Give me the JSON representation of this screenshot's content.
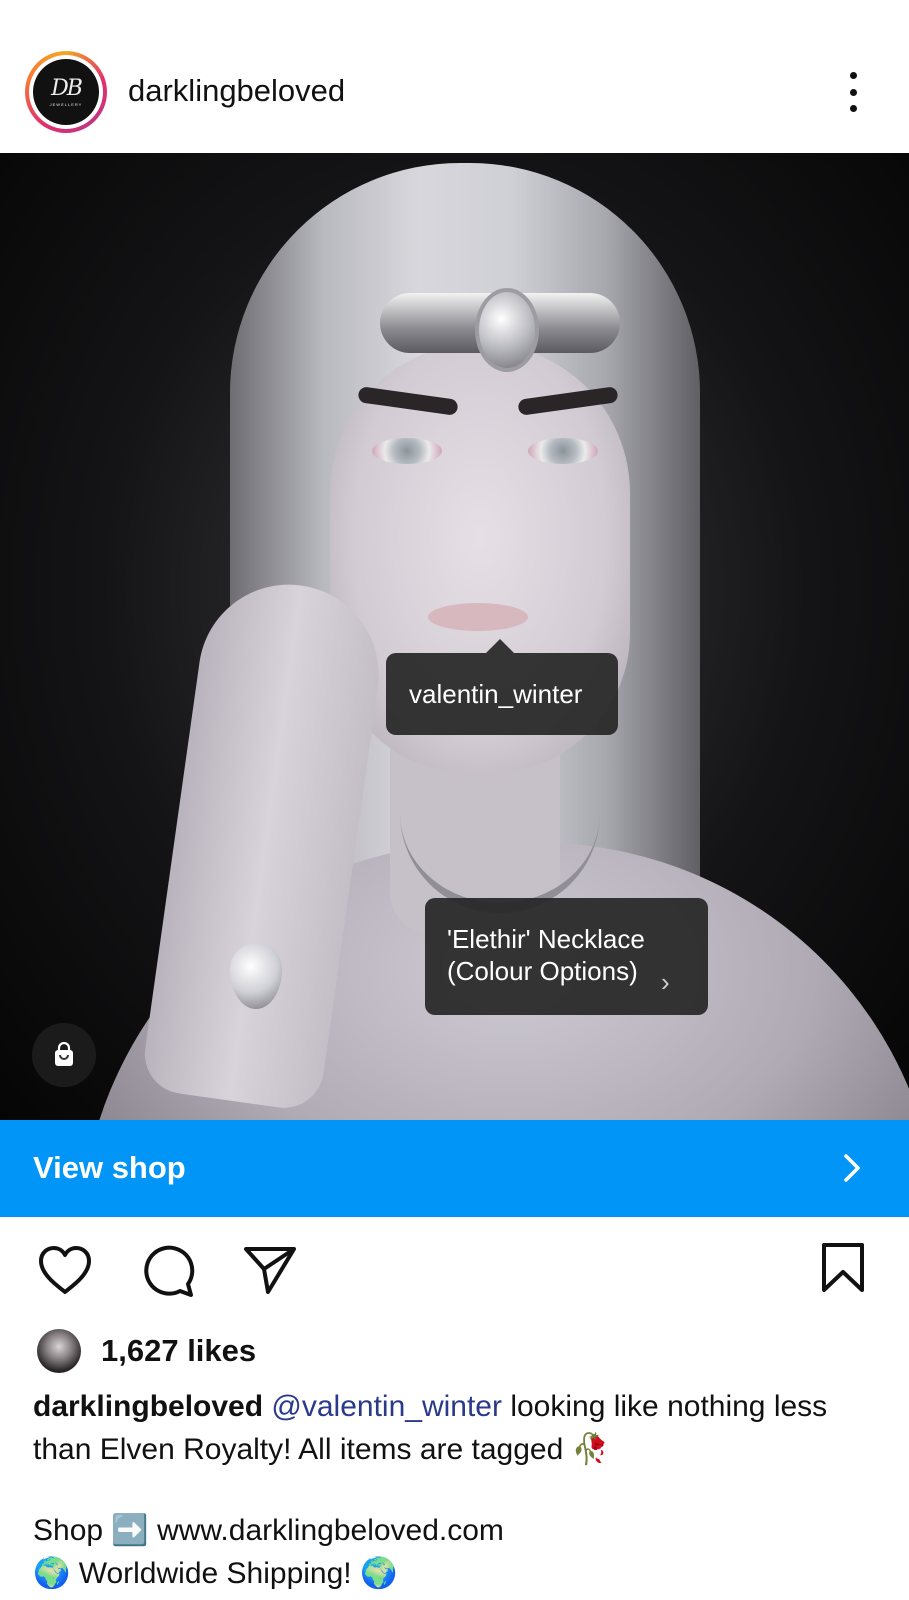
{
  "header": {
    "username": "darklingbeloved",
    "avatar_logo": {
      "monogram": "DB",
      "subtitle": "JEWELLERY"
    },
    "more_icon": "more-vertical-icon"
  },
  "post": {
    "tags": [
      {
        "label": "valentin_winter"
      },
      {
        "label": "'Elethir' Necklace\n(Colour Options)",
        "line1": "'Elethir' Necklace",
        "line2": "(Colour Options)"
      }
    ],
    "shop_bag_icon": "shopping-bag-icon"
  },
  "view_shop": {
    "label": "View shop"
  },
  "actions": {
    "like_icon": "heart-icon",
    "comment_icon": "comment-icon",
    "share_icon": "send-icon",
    "save_icon": "bookmark-icon"
  },
  "likes": {
    "count_text": "1,627 likes"
  },
  "caption": {
    "username": "darklingbeloved",
    "mention": "@valentin_winter",
    "text": " looking like nothing less than Elven Royalty! All items are tagged 🥀",
    "shop_line": "Shop ➡️ www.darklingbeloved.com",
    "ship_line": "🌍 Worldwide Shipping! 🌍"
  },
  "colors": {
    "accent_blue": "#0095f6",
    "mention_color": "#2a3a8a",
    "tag_bg": "#262626"
  }
}
